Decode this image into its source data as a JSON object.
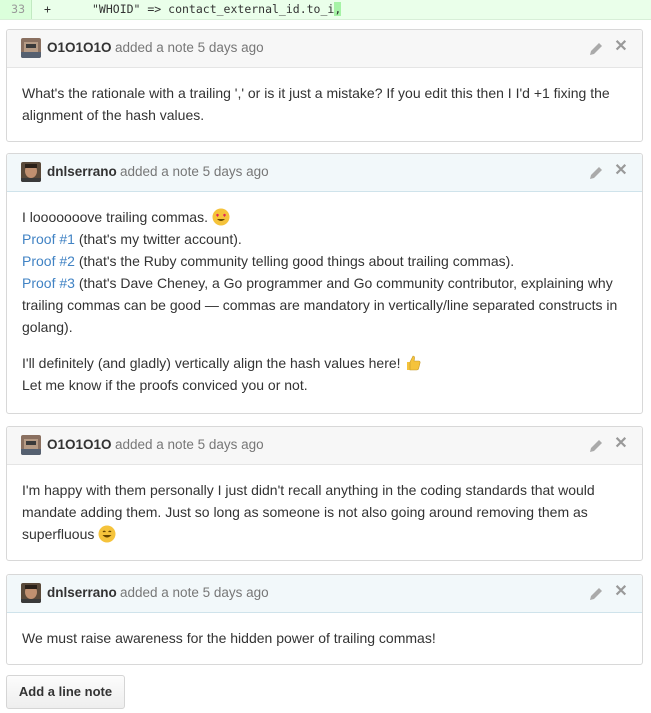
{
  "diff": {
    "line_number": "33",
    "marker": "+",
    "code_prefix": "\"WHOID\" => contact_external_id.to_i",
    "code_highlight": ","
  },
  "notes": [
    {
      "author": "O1O1O1O",
      "meta": "added a note 5 days ago",
      "paragraphs": [
        "What's the rationale with a trailing ',' or is it just a mistake? If you edit this then I I'd +1 fixing the alignment of the hash values."
      ]
    },
    {
      "author": "dnlserrano",
      "meta": "added a note 5 days ago",
      "line1": "I looooooove trailing commas.",
      "emoji1": "heart-eyes-emoji",
      "proofs": [
        {
          "link": "Proof #1",
          "text": " (that's my twitter account)."
        },
        {
          "link": "Proof #2",
          "text": " (that's the Ruby community telling good things about trailing commas)."
        },
        {
          "link": "Proof #3",
          "text": " (that's Dave Cheney, a Go programmer and Go community contributor, explaining why trailing commas can be good — commas are mandatory in vertically/line separated constructs in golang)."
        }
      ],
      "line2": "I'll definitely (and gladly) vertically align the hash values here!",
      "emoji2": "thumbs-up-emoji",
      "line3": "Let me know if the proofs conviced you or not."
    },
    {
      "author": "O1O1O1O",
      "meta": "added a note 5 days ago",
      "line1": "I'm happy with them personally I just didn't recall anything in the coding standards that would mandate adding them. Just so long as someone is not also going around removing them as superfluous",
      "emoji": "smile-emoji"
    },
    {
      "author": "dnlserrano",
      "meta": "added a note 5 days ago",
      "paragraphs": [
        "We must raise awareness for the hidden power of trailing commas!"
      ]
    }
  ],
  "add_button": "Add a line note",
  "colors": {
    "link": "#4183c4",
    "diff_bg": "#eaffea",
    "header_blue": "#f2f8fa"
  }
}
